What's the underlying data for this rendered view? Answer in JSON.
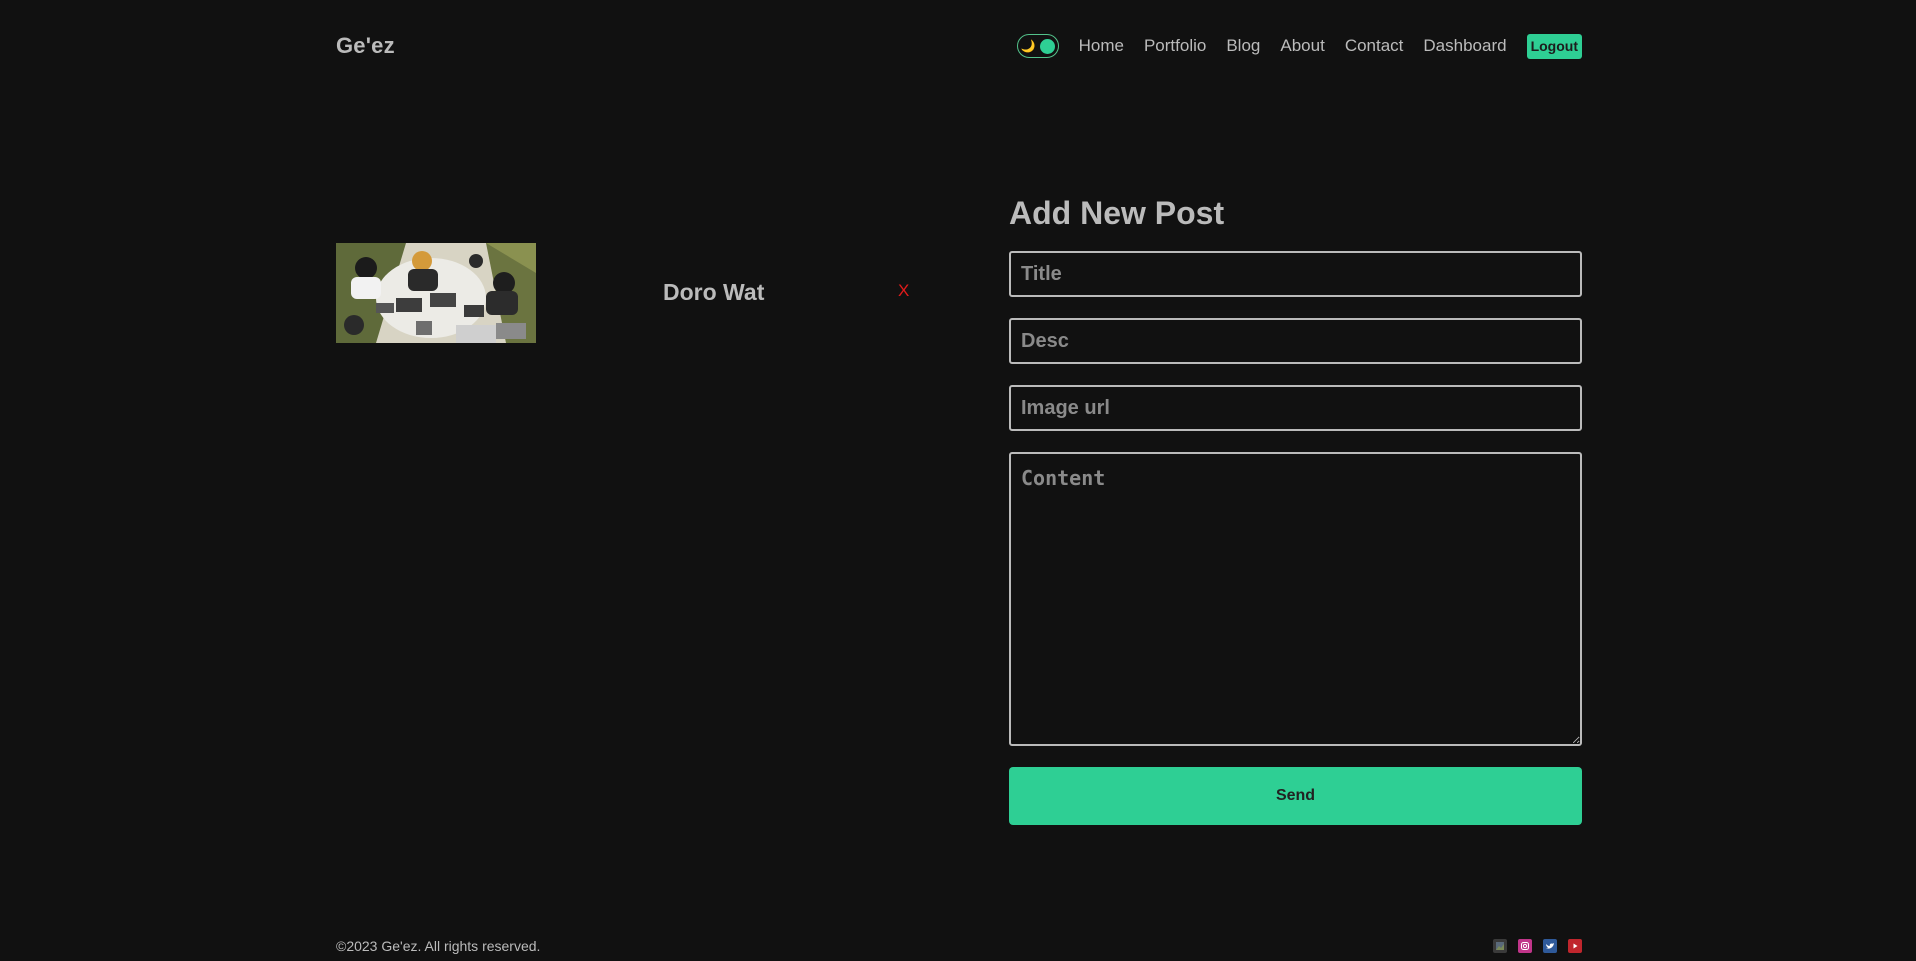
{
  "header": {
    "logo": "Ge'ez",
    "theme_toggle": {
      "icon": "moon-icon",
      "state": "dark"
    },
    "nav": [
      "Home",
      "Portfolio",
      "Blog",
      "About",
      "Contact",
      "Dashboard"
    ],
    "logout_label": "Logout"
  },
  "posts": [
    {
      "title": "Doro Wat",
      "delete_label": "X"
    }
  ],
  "form": {
    "heading": "Add New Post",
    "title_placeholder": "Title",
    "desc_placeholder": "Desc",
    "image_placeholder": "Image url",
    "content_placeholder": "Content",
    "send_label": "Send"
  },
  "footer": {
    "copyright": "©2023 Ge'ez. All rights reserved.",
    "socials": [
      "facebook-icon",
      "instagram-icon",
      "twitter-icon",
      "youtube-icon"
    ]
  },
  "colors": {
    "background": "#111111",
    "text": "#bbbbbb",
    "accent": "#2ecf94",
    "danger": "#e01b1b"
  }
}
